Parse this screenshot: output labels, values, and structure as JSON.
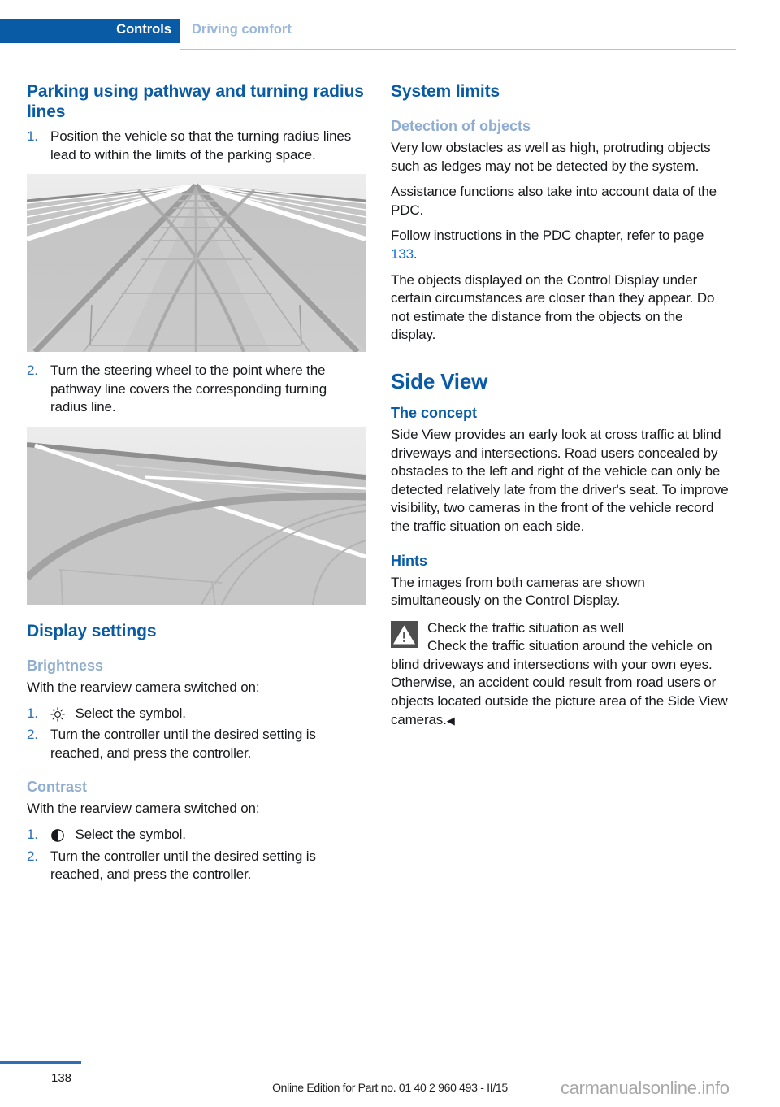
{
  "header": {
    "active_tab": "Controls",
    "inactive_tab": "Driving comfort"
  },
  "left_column": {
    "heading": "Parking using pathway and turning radius lines",
    "steps_parking": [
      {
        "num": "1.",
        "text": "Position the vehicle so that the turning radius lines lead to within the limits of the parking space."
      },
      {
        "num": "2.",
        "text": "Turn the steering wheel to the point where the pathway line covers the corresponding turning radius line."
      }
    ],
    "figure1_caption": "rearview-camera-pathway-and-turning-radius-lines-straight",
    "figure2_caption": "rearview-camera-turning-radius-line-curved",
    "display_settings_heading": "Display settings",
    "brightness_heading": "Brightness",
    "brightness_intro": "With the rearview camera switched on:",
    "brightness_steps": [
      {
        "num": "1.",
        "icon": "brightness-sun-icon",
        "text": "Select the symbol."
      },
      {
        "num": "2.",
        "icon": "",
        "text": "Turn the controller until the desired setting is reached, and press the controller."
      }
    ],
    "contrast_heading": "Contrast",
    "contrast_intro": "With the rearview camera switched on:",
    "contrast_steps": [
      {
        "num": "1.",
        "icon": "contrast-half-circle-icon",
        "text": "Select the symbol."
      },
      {
        "num": "2.",
        "icon": "",
        "text": "Turn the controller until the desired setting is reached, and press the controller."
      }
    ]
  },
  "right_column": {
    "system_limits_heading": "System limits",
    "detection_heading": "Detection of objects",
    "detection_p1": "Very low obstacles as well as high, protruding objects such as ledges may not be detected by the system.",
    "detection_p2": "Assistance functions also take into account data of the PDC.",
    "detection_p3_before": "Follow instructions in the PDC chapter, refer to page ",
    "detection_p3_pageref": "133",
    "detection_p3_after": ".",
    "detection_p4": "The objects displayed on the Control Display under certain circumstances are closer than they appear. Do not estimate the distance from the objects on the display.",
    "side_view_heading": "Side View",
    "concept_heading": "The concept",
    "concept_text": "Side View provides an early look at cross traffic at blind driveways and intersections. Road users concealed by obstacles to the left and right of the vehicle can only be detected relatively late from the driver's seat. To improve visibility, two cameras in the front of the vehicle record the traffic situation on each side.",
    "hints_heading": "Hints",
    "hints_text": "The images from both cameras are shown simultaneously on the Control Display.",
    "warning_icon": "warning-triangle-icon",
    "warning_title": "Check the traffic situation as well",
    "warning_body": "Check the traffic situation around the vehicle on blind driveways and intersections with your own eyes. Otherwise, an accident could result from road users or objects located outside the picture area of the Side View cameras.",
    "warning_endmark": "◀"
  },
  "footer": {
    "page_number": "138",
    "edition_note": "Online Edition for Part no. 01 40 2 960 493 - II/15",
    "watermark": "carmanualsonline.info"
  },
  "colors": {
    "brand_blue": "#0a5ba6",
    "light_blue": "#8fadd0",
    "page_ref_blue": "#1470e0",
    "rule_blue": "#a9c6e3",
    "footer_rule_blue": "#2b6fb8",
    "text_black": "#17191c",
    "warning_gray": "#4e4e4e",
    "watermark_gray": "#a8a8a8"
  }
}
